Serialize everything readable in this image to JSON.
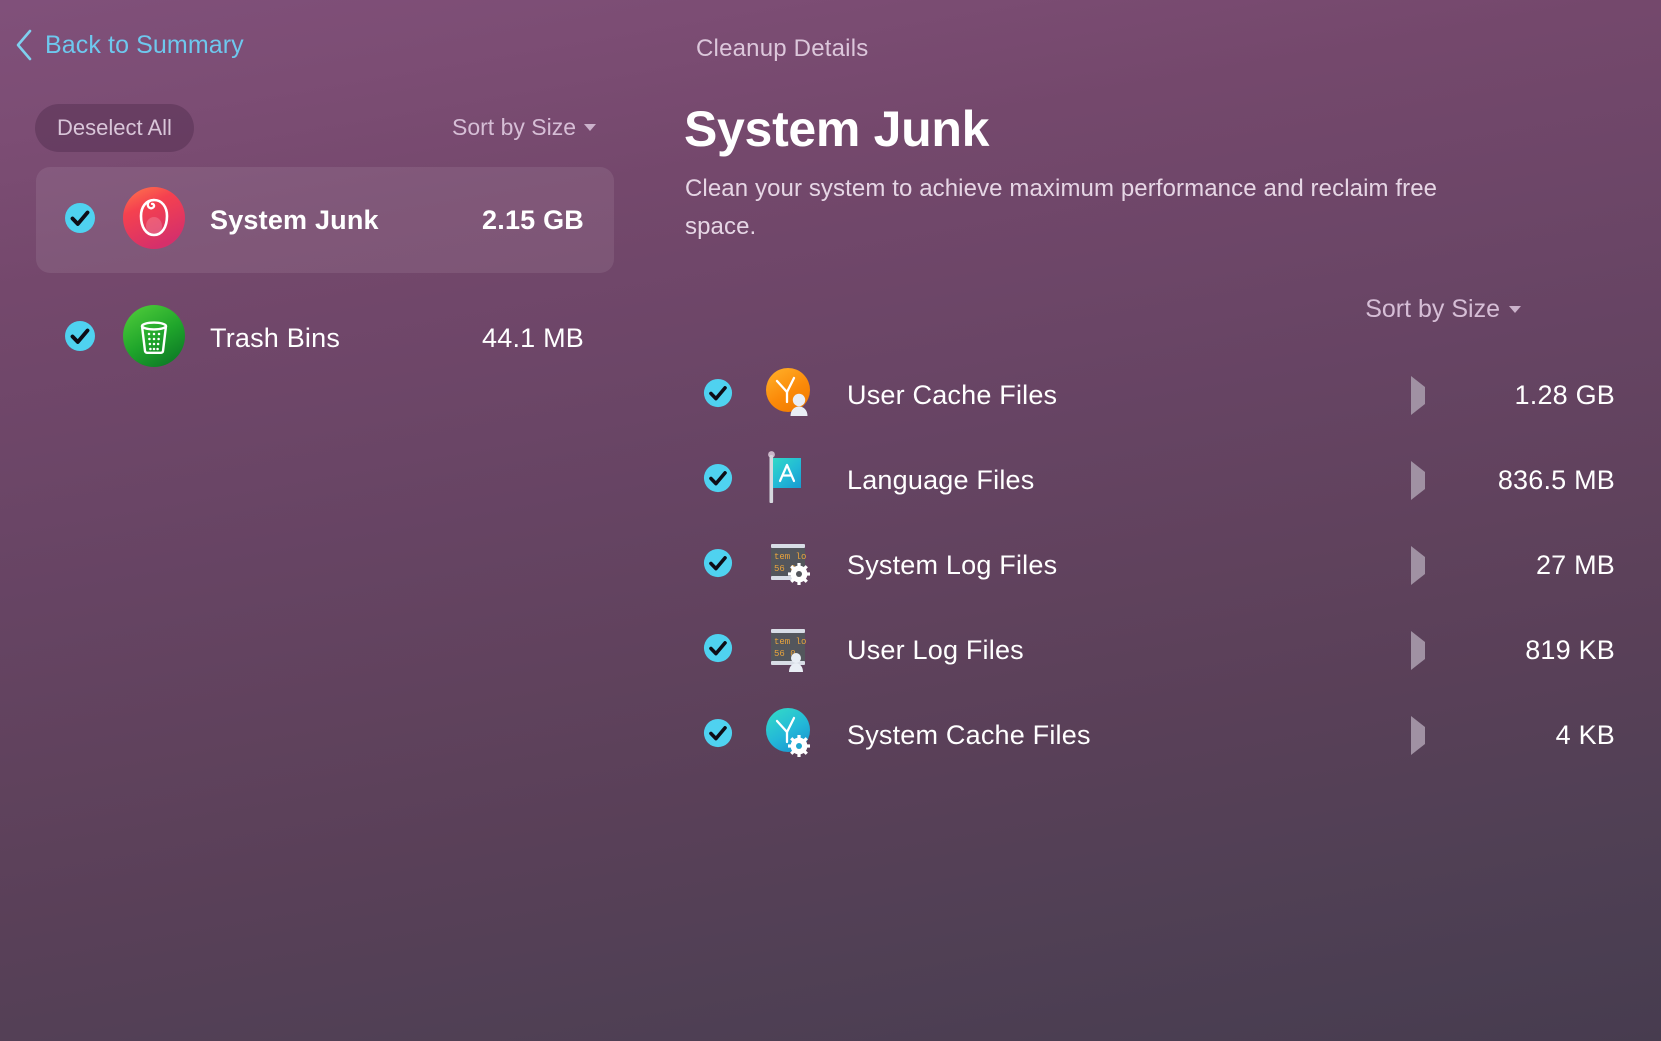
{
  "nav": {
    "back_label": "Back to Summary",
    "back_icon": "chevron-left-icon"
  },
  "sidebar": {
    "deselect_all_label": "Deselect All",
    "sort_label": "Sort by Size",
    "sort_caret_icon": "caret-down-icon",
    "items": [
      {
        "label": "System Junk",
        "size": "2.15 GB",
        "icon": "system-junk-icon",
        "checked": true,
        "selected": true
      },
      {
        "label": "Trash Bins",
        "size": "44.1 MB",
        "icon": "trash-bin-icon",
        "checked": true,
        "selected": false
      }
    ]
  },
  "detail": {
    "breadcrumb": "Cleanup Details",
    "title": "System Junk",
    "subtitle": "Clean your system to achieve maximum performance and reclaim free space.",
    "sort_label": "Sort by Size",
    "sort_caret_icon": "caret-down-icon",
    "rows": [
      {
        "label": "User Cache Files",
        "size": "1.28 GB",
        "icon": "user-cache-clock-icon",
        "checked": true,
        "disclosure_icon": "triangle-right-icon"
      },
      {
        "label": "Language Files",
        "size": "836.5 MB",
        "icon": "language-flag-appstore-icon",
        "checked": true,
        "disclosure_icon": "triangle-right-icon"
      },
      {
        "label": "System Log Files",
        "size": "27 MB",
        "icon": "system-log-terminal-icon",
        "checked": true,
        "disclosure_icon": "triangle-right-icon",
        "terminal_text_line1": "tem lo",
        "terminal_text_line2": "56 0"
      },
      {
        "label": "User Log Files",
        "size": "819 KB",
        "icon": "user-log-terminal-icon",
        "checked": true,
        "disclosure_icon": "triangle-right-icon",
        "terminal_text_line1": "tem lo",
        "terminal_text_line2": "56 0"
      },
      {
        "label": "System Cache Files",
        "size": "4 KB",
        "icon": "system-cache-clock-icon",
        "checked": true,
        "disclosure_icon": "triangle-right-icon"
      }
    ]
  },
  "colors": {
    "accent_link": "#6ec8ee",
    "checkbox_fill": "#4fd2f0",
    "checkbox_mark": "#101018",
    "background_top": "#80507a",
    "background_bottom": "#473c4f",
    "disclosure_arrow": "#a091a3"
  }
}
